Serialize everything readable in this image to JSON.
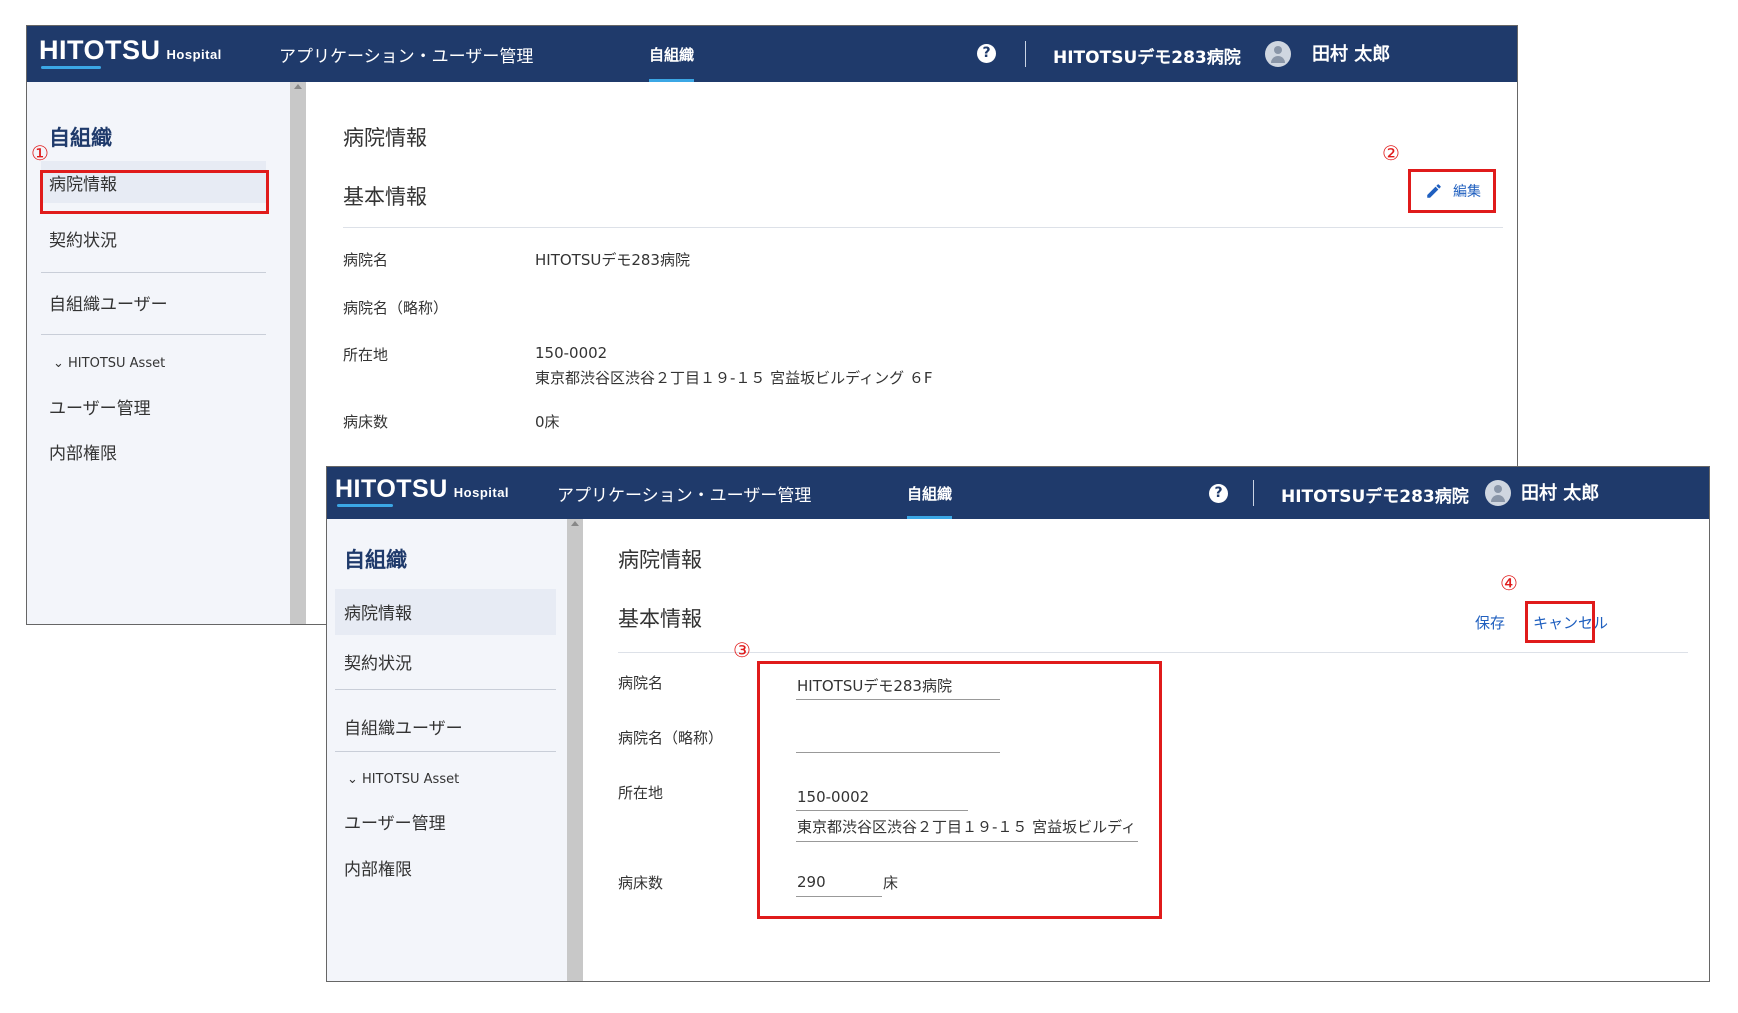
{
  "colors": {
    "header": "#1f3a6b",
    "accent": "#3ba7e5",
    "link": "#1f5fbf",
    "sidebar": "#f3f5fa",
    "callout": "#e01b1b"
  },
  "header": {
    "logo_main": "HITOTSU",
    "logo_sub": "Hospital",
    "nav": [
      "アプリケーション・ユーザー管理",
      "自組織"
    ],
    "help_icon": "question-circle",
    "hospital_name": "HITOTSUデモ283病院",
    "user_name": "田村 太郎"
  },
  "sidebar": {
    "title": "自組織",
    "items": [
      "病院情報",
      "契約状況",
      "自組織ユーザー"
    ],
    "group_label": "HITOTSU Asset",
    "group_items": [
      "ユーザー管理",
      "内部権限"
    ]
  },
  "main": {
    "page_title": "病院情報",
    "section_title": "基本情報",
    "edit_label": "編集",
    "save_label": "保存",
    "cancel_label": "キャンセル"
  },
  "fields": {
    "name_label": "病院名",
    "short_name_label": "病院名（略称）",
    "address_label": "所在地",
    "beds_label": "病床数"
  },
  "view_values": {
    "name": "HITOTSUデモ283病院",
    "short_name": "",
    "postal": "150-0002",
    "address": "東京都渋谷区渋谷２丁目１９-１５ 宮益坂ビルディング ６F",
    "beds": "0床"
  },
  "edit_values": {
    "name": "HITOTSUデモ283病院",
    "short_name": "",
    "postal": "150-0002",
    "address": "東京都渋谷区渋谷２丁目１９-１５ 宮益坂ビルディ",
    "beds": "290",
    "beds_unit": "床"
  },
  "callouts": [
    "①",
    "②",
    "③",
    "④"
  ]
}
